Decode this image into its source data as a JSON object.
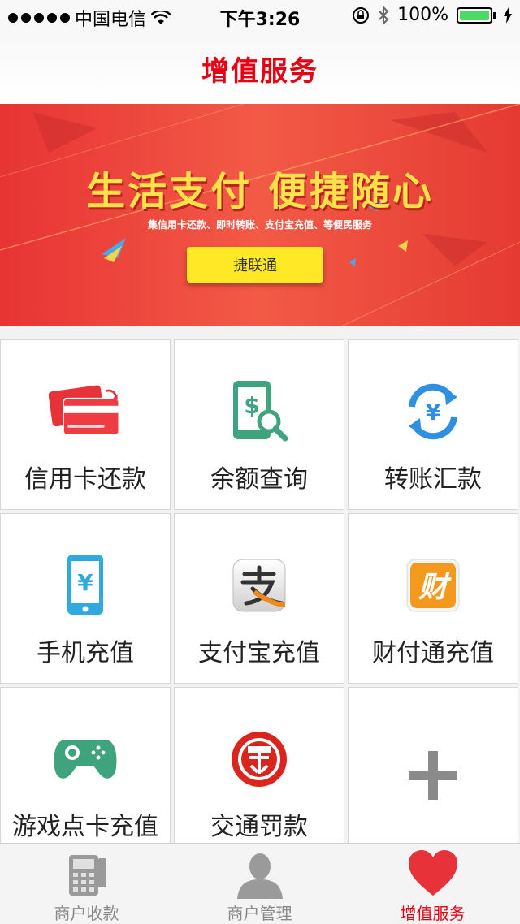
{
  "status_bar": {
    "carrier": "中国电信",
    "time": "下午3:26",
    "battery": "100%"
  },
  "header": {
    "title": "增值服务"
  },
  "banner": {
    "headline": "生活支付 便捷随心",
    "subtitle": "集信用卡还款、即时转账、支付宝充值、等便民服务",
    "button_label": "捷联通"
  },
  "services": [
    {
      "label": "信用卡还款",
      "icon": "credit-card-icon"
    },
    {
      "label": "余额查询",
      "icon": "balance-query-icon"
    },
    {
      "label": "转账汇款",
      "icon": "transfer-icon"
    },
    {
      "label": "手机充值",
      "icon": "mobile-recharge-icon"
    },
    {
      "label": "支付宝充值",
      "icon": "alipay-icon"
    },
    {
      "label": "财付通充值",
      "icon": "tenpay-icon"
    },
    {
      "label": "游戏点卡充值",
      "icon": "gamepad-icon"
    },
    {
      "label": "交通罚款",
      "icon": "traffic-fine-icon"
    },
    {
      "label": "",
      "icon": "plus-icon"
    }
  ],
  "tabs": [
    {
      "label": "商户收款",
      "icon": "pos-terminal-icon"
    },
    {
      "label": "商户管理",
      "icon": "user-icon"
    },
    {
      "label": "增值服务",
      "icon": "heart-icon",
      "active": true
    }
  ],
  "colors": {
    "accent": "#e60012",
    "banner_red": "#e83434",
    "banner_yellow": "#ffe826"
  }
}
